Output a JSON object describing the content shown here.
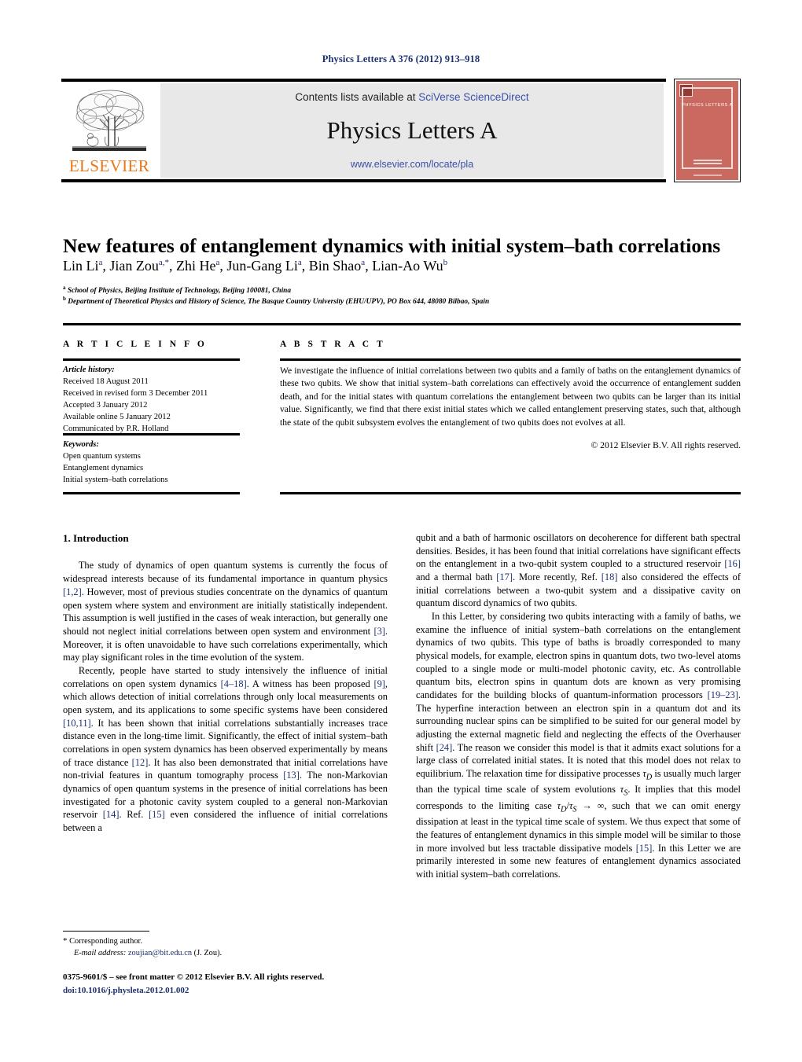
{
  "running_head": "Physics Letters A 376 (2012) 913–918",
  "masthead": {
    "publisher_name": "ELSEVIER",
    "contents_prefix": "Contents lists available at ",
    "contents_link": "SciVerse ScienceDirect",
    "journal_title": "Physics Letters A",
    "journal_url": "www.elsevier.com/locate/pla",
    "cover_title": "PHYSICS LETTERS A"
  },
  "article": {
    "title": "New features of entanglement dynamics with initial system–bath correlations",
    "authors_html": "Lin Li<sup>a</sup>, Jian Zou<sup>a,*</sup>, Zhi He<sup>a</sup>, Jun-Gang Li<sup>a</sup>, Bin Shao<sup>a</sup>, Lian-Ao Wu<sup>b</sup>",
    "affiliation_a": "School of Physics, Beijing Institute of Technology, Beijing 100081, China",
    "affiliation_b": "Department of Theoretical Physics and History of Science, The Basque Country University (EHU/UPV), PO Box 644, 48080 Bilbao, Spain"
  },
  "info": {
    "heading": "A R T I C L E    I N F O",
    "history_label": "Article history:",
    "history": [
      "Received 18 August 2011",
      "Received in revised form 3 December 2011",
      "Accepted 3 January 2012",
      "Available online 5 January 2012",
      "Communicated by P.R. Holland"
    ],
    "keywords_label": "Keywords:",
    "keywords": [
      "Open quantum systems",
      "Entanglement dynamics",
      "Initial system–bath correlations"
    ]
  },
  "abstract": {
    "heading": "A B S T R A C T",
    "text": "We investigate the influence of initial correlations between two qubits and a family of baths on the entanglement dynamics of these two qubits. We show that initial system–bath correlations can effectively avoid the occurrence of entanglement sudden death, and for the initial states with quantum correlations the entanglement between two qubits can be larger than its initial value. Significantly, we find that there exist initial states which we called entanglement preserving states, such that, although the state of the qubit subsystem evolves the entanglement of two qubits does not evolves at all.",
    "copyright": "© 2012 Elsevier B.V. All rights reserved."
  },
  "body": {
    "section_heading": "1. Introduction",
    "left_paragraphs": [
      "The study of dynamics of open quantum systems is currently the focus of widespread interests because of its fundamental importance in quantum physics [1,2]. However, most of previous studies concentrate on the dynamics of quantum open system where system and environment are initially statistically independent. This assumption is well justified in the cases of weak interaction, but generally one should not neglect initial correlations between open system and environment [3]. Moreover, it is often unavoidable to have such correlations experimentally, which may play significant roles in the time evolution of the system.",
      "Recently, people have started to study intensively the influence of initial correlations on open system dynamics [4–18]. A witness has been proposed [9], which allows detection of initial correlations through only local measurements on open system, and its applications to some specific systems have been considered [10,11]. It has been shown that initial correlations substantially increases trace distance even in the long-time limit. Significantly, the effect of initial system–bath correlations in open system dynamics has been observed experimentally by means of trace distance [12]. It has also been demonstrated that initial correlations have non-trivial features in quantum tomography process [13]. The non-Markovian dynamics of open quantum systems in the presence of initial correlations has been investigated for a photonic cavity system coupled to a general non-Markovian reservoir [14]. Ref. [15] even considered the influence of initial correlations between a"
    ],
    "right_paragraphs": [
      "qubit and a bath of harmonic oscillators on decoherence for different bath spectral densities. Besides, it has been found that initial correlations have significant effects on the entanglement in a two-qubit system coupled to a structured reservoir [16] and a thermal bath [17]. More recently, Ref. [18] also considered the effects of initial correlations between a two-qubit system and a dissipative cavity on quantum discord dynamics of two qubits.",
      "In this Letter, by considering two qubits interacting with a family of baths, we examine the influence of initial system–bath correlations on the entanglement dynamics of two qubits. This type of baths is broadly corresponded to many physical models, for example, electron spins in quantum dots, two two-level atoms coupled to a single mode or multi-model photonic cavity, etc. As controllable quantum bits, electron spins in quantum dots are known as very promising candidates for the building blocks of quantum-information processors [19–23]. The hyperfine interaction between an electron spin in a quantum dot and its surrounding nuclear spins can be simplified to be suited for our general model by adjusting the external magnetic field and neglecting the effects of the Overhauser shift [24]. The reason we consider this model is that it admits exact solutions for a large class of correlated initial states. It is noted that this model does not relax to equilibrium. The relaxation time for dissipative processes τD is usually much larger than the typical time scale of system evolutions τS. It implies that this model corresponds to the limiting case τD/τS → ∞, such that we can omit energy dissipation at least in the typical time scale of system. We thus expect that some of the features of entanglement dynamics in this simple model will be similar to those in more involved but less tractable dissipative models [15]. In this Letter we are primarily interested in some new features of entanglement dynamics associated with initial system–bath correlations."
    ]
  },
  "footnotes": {
    "corresponding_marker": "*",
    "corresponding_text": "Corresponding author.",
    "email_label": "E-mail address:",
    "email": "zoujian@bit.edu.cn",
    "email_owner": "(J. Zou)."
  },
  "imprint": {
    "line1": "0375-9601/$ – see front matter  © 2012 Elsevier B.V. All rights reserved.",
    "doi": "doi:10.1016/j.physleta.2012.01.002"
  },
  "colors": {
    "link": "#1c3070",
    "sciencedirect": "#3a50a8",
    "elsevier_orange": "#e8761a",
    "cover_red": "#c9695f",
    "banner_gray": "#e8e8e8"
  }
}
